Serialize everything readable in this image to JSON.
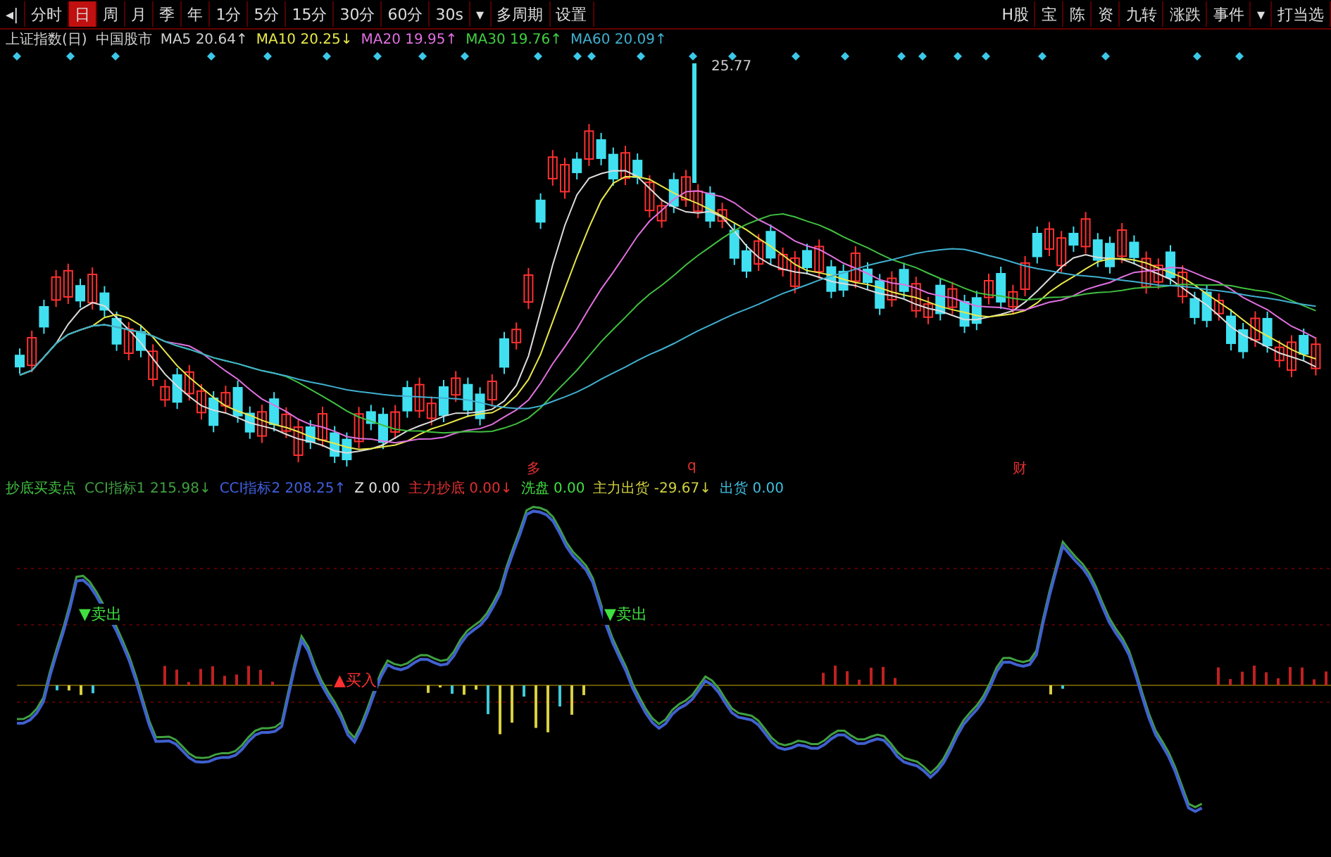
{
  "toolbar": {
    "left": [
      {
        "label": "◂|",
        "selected": false
      },
      {
        "label": "分时",
        "selected": false
      },
      {
        "label": "日",
        "selected": true
      },
      {
        "label": "周",
        "selected": false
      },
      {
        "label": "月",
        "selected": false
      },
      {
        "label": "季",
        "selected": false
      },
      {
        "label": "年",
        "selected": false
      },
      {
        "label": "1分",
        "selected": false
      },
      {
        "label": "5分",
        "selected": false
      },
      {
        "label": "15分",
        "selected": false
      },
      {
        "label": "30分",
        "selected": false
      },
      {
        "label": "60分",
        "selected": false
      },
      {
        "label": "30s",
        "selected": false
      },
      {
        "label": "▾",
        "selected": false
      },
      {
        "label": "多周期",
        "selected": false
      },
      {
        "label": "设置",
        "selected": false
      }
    ],
    "right": [
      {
        "label": "H股"
      },
      {
        "label": "宝"
      },
      {
        "label": "陈"
      },
      {
        "label": "资"
      },
      {
        "label": "九转"
      },
      {
        "label": "涨跌"
      },
      {
        "label": "事件"
      },
      {
        "label": "▾"
      },
      {
        "label": "打当选"
      }
    ]
  },
  "price_legend": [
    {
      "text": "上证指数(日)",
      "color": "#d0d0d0"
    },
    {
      "text": "中国股市",
      "color": "#d0d0d0"
    },
    {
      "text": "MA5 20.64↑",
      "color": "#d0d0d0"
    },
    {
      "text": "MA10 20.25↓",
      "color": "#e8e84a"
    },
    {
      "text": "MA20 19.95↑",
      "color": "#e070e0"
    },
    {
      "text": "MA30 19.76↑",
      "color": "#40d040"
    },
    {
      "text": "MA60 20.09↑",
      "color": "#40b0d0"
    }
  ],
  "high_label": "25.77",
  "event_markers": [
    "多",
    "q",
    "财"
  ],
  "indicator_legend": [
    {
      "text": "抄底买卖点",
      "color": "#40c040"
    },
    {
      "text": "CCI指标1 215.98↓",
      "color": "#40a040"
    },
    {
      "text": "CCI指标2 208.25↑",
      "color": "#4060e0"
    },
    {
      "text": "Z 0.00",
      "color": "#e0e0e0"
    },
    {
      "text": "主力抄底 0.00↓",
      "color": "#e03030"
    },
    {
      "text": "洗盘 0.00",
      "color": "#40e040"
    },
    {
      "text": "主力出货 -29.67↓",
      "color": "#d0d040"
    },
    {
      "text": "出货 0.00",
      "color": "#40c0e0"
    }
  ],
  "signals": [
    {
      "kind": "sell",
      "text": "▼卖出"
    },
    {
      "kind": "buy",
      "text": "▲买入"
    },
    {
      "kind": "sell",
      "text": "▼卖出"
    }
  ]
}
